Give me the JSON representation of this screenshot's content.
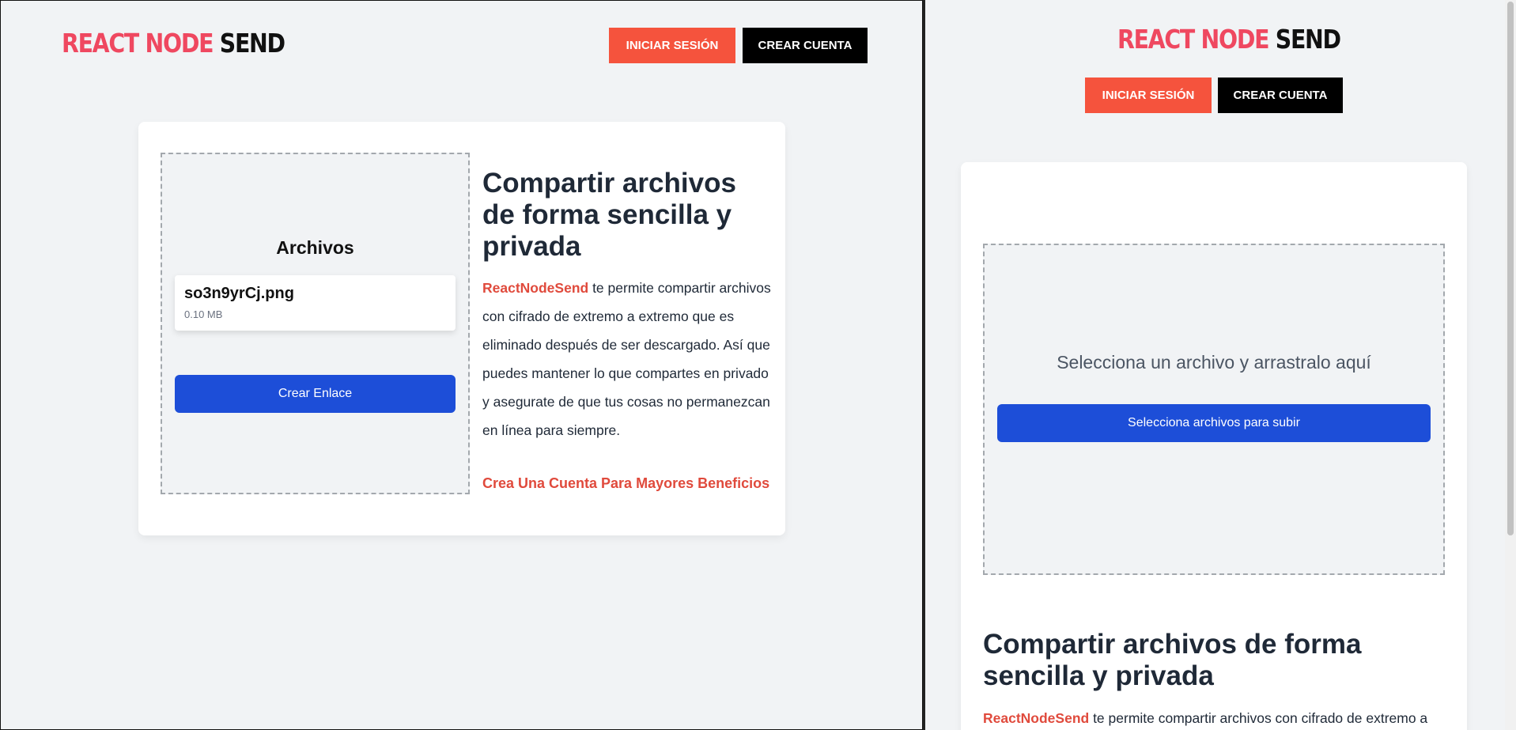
{
  "logo": {
    "brand": "REACT NODE",
    "send": "SEND"
  },
  "header": {
    "login_label": "INICIAR SESIÓN",
    "signup_label": "CREAR CUENTA"
  },
  "left": {
    "files_title": "Archivos",
    "file": {
      "name": "so3n9yrCj.png",
      "size": "0.10 MB"
    },
    "create_link_label": "Crear Enlace"
  },
  "right": {
    "dropzone_prompt": "Selecciona un archivo y arrastralo aquí",
    "select_files_label": "Selecciona archivos para subir"
  },
  "info": {
    "heading": "Compartir archivos de forma sencilla y privada",
    "brand_name": "ReactNodeSend",
    "description_left": " te permite compartir archivos con cifrado de extremo a extremo que es eliminado después de ser descargado. Así que puedes mantener lo que compartes en privado y asegurate de que tus cosas no permanezcan en línea para siempre.",
    "description_right": " te permite compartir archivos con cifrado de extremo a",
    "cta": "Crea Una Cuenta Para Mayores Beneficios"
  },
  "colors": {
    "brand_red": "#ef4860",
    "login_orange": "#f5533d",
    "primary_blue": "#1d4ed8",
    "background": "#f1f3f5"
  }
}
